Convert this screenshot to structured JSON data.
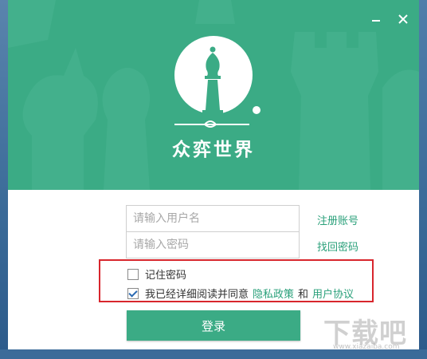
{
  "window": {
    "minimize_icon": "minimize-icon",
    "close_icon": "close-icon",
    "app_title": "众弈世界",
    "logo_icon": "chess-bishop-logo"
  },
  "form": {
    "username_placeholder": "请输入用户名",
    "username_value": "",
    "password_placeholder": "请输入密码",
    "password_value": "",
    "register_link": "注册账号",
    "find_password_link": "找回密码",
    "remember_label": "记住密码",
    "remember_checked": false,
    "agree_prefix": "我已经详细阅读并同意",
    "privacy_link": "隐私政策",
    "and_text": "和",
    "user_agreement_link": "用户协议",
    "agree_checked": true,
    "login_button": "登录"
  },
  "watermark": {
    "text": "下载吧",
    "sub": "www.xiazaiba.com"
  },
  "colors": {
    "brand_green": "#3bab85",
    "link_green": "#2aa07a",
    "highlight_red": "#d8262d"
  }
}
